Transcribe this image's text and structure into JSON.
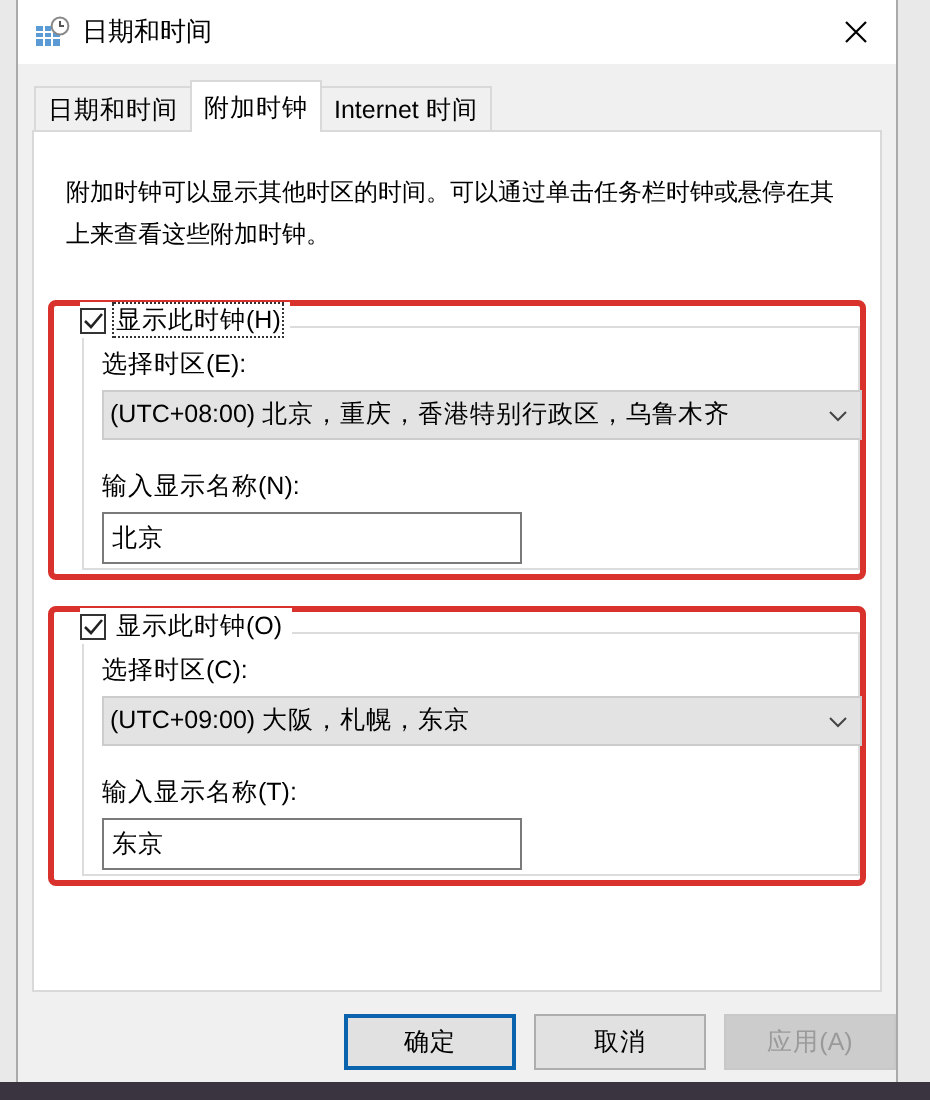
{
  "window": {
    "title": "日期和时间"
  },
  "tabs": [
    {
      "label": "日期和时间",
      "selected": false
    },
    {
      "label": "附加时钟",
      "selected": true
    },
    {
      "label": "Internet 时间",
      "selected": false
    }
  ],
  "description": "附加时钟可以显示其他时区的时间。可以通过单击任务栏时钟或悬停在其上来查看这些附加时钟。",
  "clocks": [
    {
      "show_label": "显示此时钟(H)",
      "checked": true,
      "focused": true,
      "highlighted": true,
      "timezone_label": "选择时区(E):",
      "timezone": "(UTC+08:00) 北京，重庆，香港特别行政区，乌鲁木齐",
      "name_label": "输入显示名称(N):",
      "name": "北京"
    },
    {
      "show_label": "显示此时钟(O)",
      "checked": true,
      "focused": false,
      "highlighted": true,
      "timezone_label": "选择时区(C):",
      "timezone": "(UTC+09:00) 大阪，札幌，东京",
      "name_label": "输入显示名称(T):",
      "name": "东京"
    }
  ],
  "buttons": [
    {
      "label": "确定",
      "default": true,
      "disabled": false
    },
    {
      "label": "取消",
      "default": false,
      "disabled": false
    },
    {
      "label": "应用(A)",
      "default": false,
      "disabled": true
    }
  ]
}
